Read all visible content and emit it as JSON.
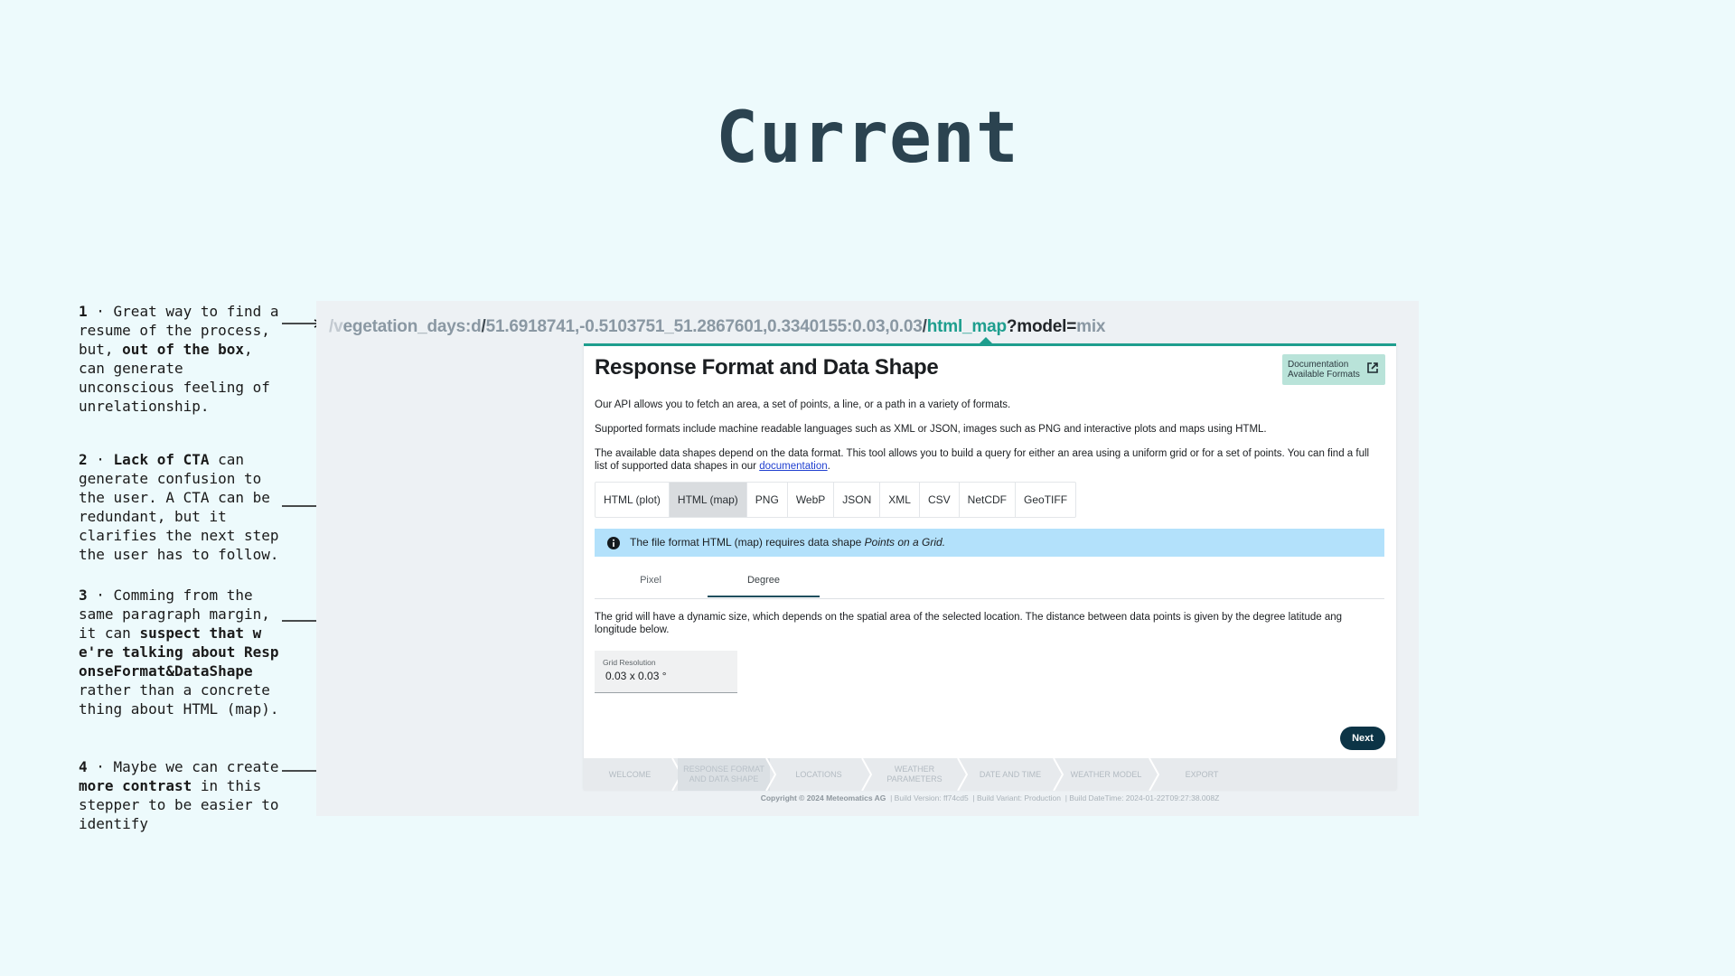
{
  "slide": {
    "title": "Current"
  },
  "notes": [
    {
      "num": "1",
      "text_a": " · Great way to find a resume of the process, but, ",
      "bold": "out of the box",
      "text_b": ", can generate unconscious feeling of unrelationship."
    },
    {
      "num": "2",
      "text_a": " · ",
      "bold": "Lack of CTA",
      "text_b": " can generate confusion to the user. A CTA can be redundant, but it clarifies the next step the user has to follow."
    },
    {
      "num": "3",
      "text_a": " · Comming from the same paragraph margin, it can ",
      "bold": "suspect that we're talking about ResponseFormat&DataShape",
      "text_b": " rather than a concrete thing about HTML (map)."
    },
    {
      "num": "4",
      "text_a": " · Maybe we can create ",
      "bold": "more contrast",
      "text_b": " in this stepper to be easier to identify"
    }
  ],
  "url": {
    "seg1": "/v",
    "seg2": "egetation_days:d",
    "sep1": "/",
    "coords": "51.6918741,-0.5103751_51.2867601,0.3340155:0.03,0.03",
    "sep2": "/",
    "format": "html_map",
    "query": "?model=",
    "model": "mix"
  },
  "card": {
    "title": "Response Format and Data Shape",
    "doc_line1": "Documentation",
    "doc_line2": "Available Formats",
    "p1": "Our API allows you to fetch an area, a set of points, a line, or a path in a variety of formats.",
    "p2": "Supported formats include machine readable languages such as XML or JSON, images such as PNG and interactive plots and maps using HTML.",
    "p3": "The available data shapes depend on the data format. This tool allows you to build a query for either an area using a uniform grid or for a set of points. You can find a full list of supported data shapes in our ",
    "p3_link": "documentation",
    "p3_end": ".",
    "formats": [
      "HTML (plot)",
      "HTML (map)",
      "PNG",
      "WebP",
      "JSON",
      "XML",
      "CSV",
      "NetCDF",
      "GeoTIFF"
    ],
    "active_format": "HTML (map)",
    "info_text": "The file format HTML (map) requires data shape ",
    "info_em": "Points on a Grid.",
    "unit_tabs": [
      "Pixel",
      "Degree"
    ],
    "active_unit": "Degree",
    "p4": "The grid will have a dynamic size, which depends on the spatial area of the selected location. The distance between data points is given by the degree latitude ang longitude below.",
    "grid_label": "Grid Resolution",
    "grid_value": "0.03 x 0.03 °",
    "next_label": "Next"
  },
  "stepper": [
    "Welcome",
    "Response format and data shape",
    "Locations",
    "Weather parameters",
    "Date and time",
    "Weather model",
    "Export"
  ],
  "footer": {
    "copyright": "Copyright © 2024 Meteomatics AG",
    "build_version": "| Build Version: ff74cd5",
    "build_variant": "| Build Variant: Production",
    "build_datetime": "| Build DateTime: 2024-01-22T09:27:38.008Z"
  },
  "colors": {
    "background": "#edfafc",
    "accent_teal": "#1e9e8e",
    "info_blue": "#b3e1fb",
    "next_button": "#0c3446"
  }
}
